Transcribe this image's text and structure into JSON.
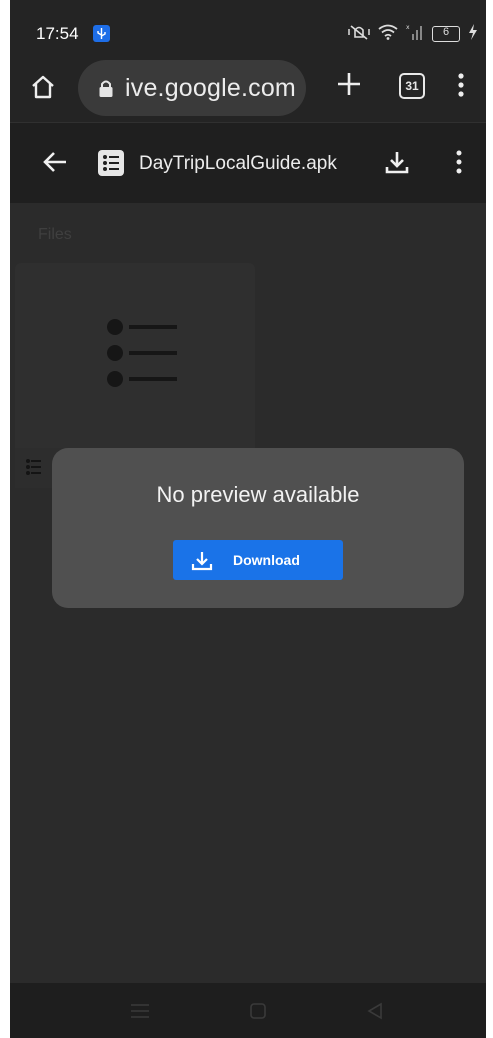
{
  "status_bar": {
    "time": "17:54",
    "battery": "6",
    "icons": [
      "usb-icon",
      "mute-vibrate-icon",
      "wifi-icon",
      "signal-icon",
      "battery-icon",
      "charging-icon"
    ]
  },
  "browser": {
    "url": "ive.google.com",
    "tab_count": "31",
    "icons": [
      "home-icon",
      "lock-icon",
      "new-tab-plus-icon",
      "tab-switcher-icon",
      "menu-kebab-icon"
    ]
  },
  "drive": {
    "file_name": "DayTripLocalGuide.apk",
    "files_label": "Files"
  },
  "dialog": {
    "message": "No preview available",
    "download_label": "Download"
  },
  "nav": {
    "icons": [
      "recents-menu-icon",
      "home-square-icon",
      "back-triangle-icon"
    ]
  },
  "colors": {
    "accent": "#1a73e8",
    "background": "#232323",
    "dialog": "#505050"
  }
}
